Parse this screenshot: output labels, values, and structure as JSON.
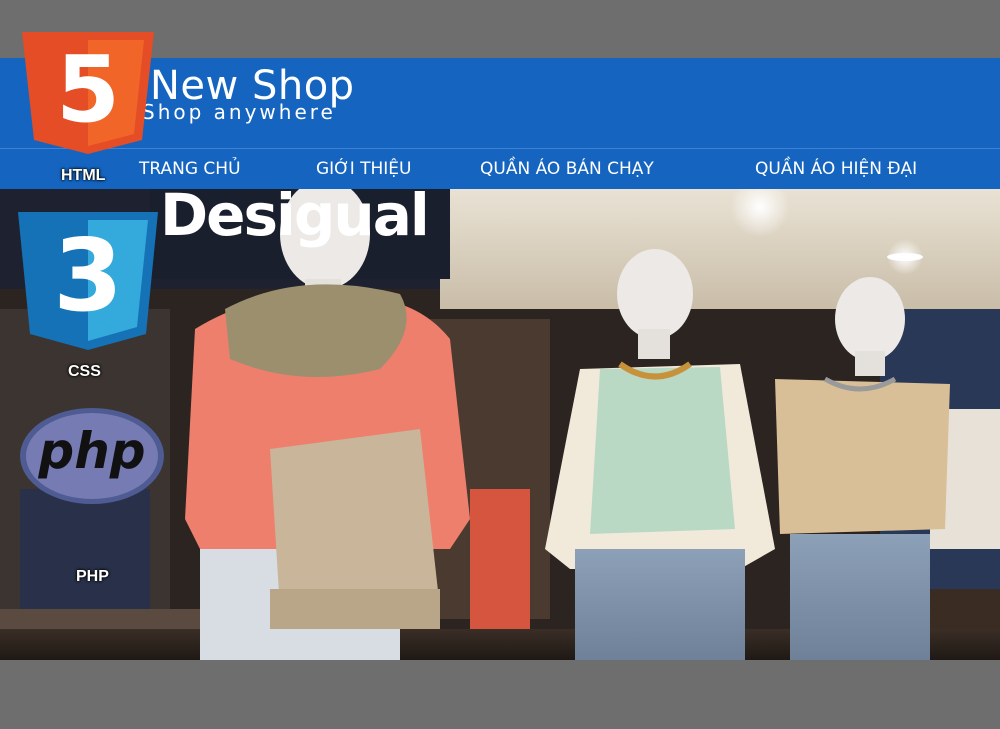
{
  "brand": {
    "title": "New Shop",
    "tagline": "Shop anywhere"
  },
  "nav": {
    "items": [
      {
        "label": "TRANG CHỦ"
      },
      {
        "label": "GIỚI THIỆU"
      },
      {
        "label": "QUẦN ÁO BÁN CHẠY"
      },
      {
        "label": "QUẦN ÁO HIỆN ĐẠI"
      }
    ]
  },
  "badges": {
    "html": {
      "label": "HTML",
      "number": "5",
      "icon": "html5-logo-icon"
    },
    "css": {
      "label": "CSS",
      "number": "3",
      "icon": "css3-logo-icon"
    },
    "php": {
      "label": "PHP",
      "logo_text": "php",
      "icon": "php-logo-icon"
    }
  },
  "hero": {
    "store_sign": "Desigual",
    "description_icon": "mannequins-storefront-photo"
  },
  "colors": {
    "header_blue": "#1565c0",
    "page_gray": "#6e6e6e",
    "html5_orange": "#e44d26",
    "css3_blue": "#1572b6",
    "php_purple": "#777bb3"
  }
}
